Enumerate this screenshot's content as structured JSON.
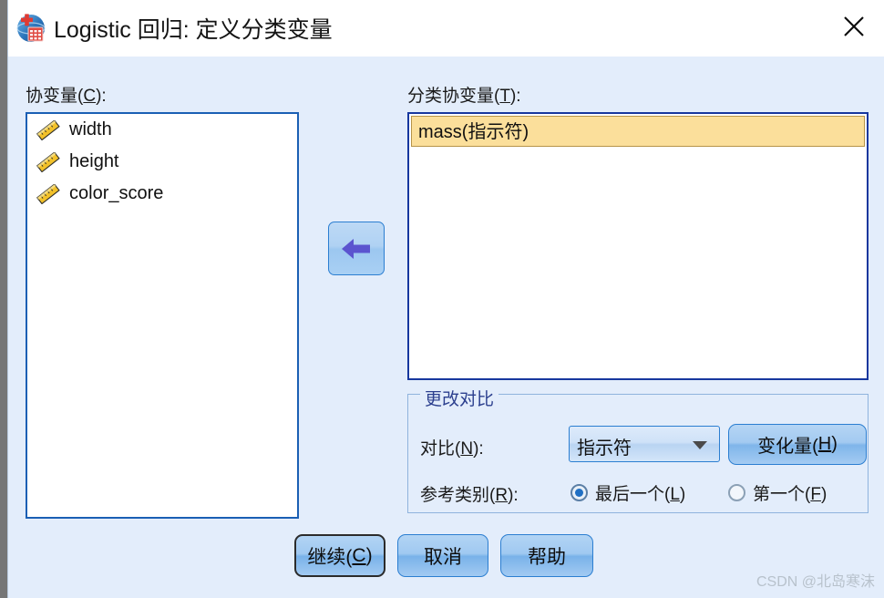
{
  "window": {
    "title": "Logistic 回归: 定义分类变量",
    "icon": "spss-logistic-icon",
    "close_label": "✕"
  },
  "left_panel": {
    "label": "协变量(C):",
    "label_text": "协变量(",
    "label_mnemonic": "C",
    "label_suffix": "):",
    "variables": [
      {
        "name": "width",
        "icon": "ruler-scale-icon"
      },
      {
        "name": "height",
        "icon": "ruler-scale-icon"
      },
      {
        "name": "color_score",
        "icon": "ruler-scale-icon"
      }
    ]
  },
  "transfer": {
    "arrow_icon": "arrow-left-icon"
  },
  "right_panel": {
    "label_text": "分类协变量(",
    "label_mnemonic": "T",
    "label_suffix": "):",
    "items": [
      {
        "name": "mass(指示符)",
        "selected": true
      }
    ]
  },
  "group": {
    "title": "更改对比",
    "contrast": {
      "label_text": "对比(",
      "label_mnemonic": "N",
      "label_suffix": "):",
      "selected": "指示符",
      "options": [
        "指示符"
      ],
      "dropdown_icon": "chevron-down-icon"
    },
    "change_button": {
      "label_text": "变化量(",
      "label_mnemonic": "H",
      "label_suffix": ")"
    },
    "reference": {
      "label_text": "参考类别(",
      "label_mnemonic": "R",
      "label_suffix": "):",
      "options": [
        {
          "label_text": "最后一个(",
          "mnemonic": "L",
          "suffix": ")",
          "checked": true
        },
        {
          "label_text": "第一个(",
          "mnemonic": "F",
          "suffix": ")",
          "checked": false
        }
      ]
    }
  },
  "footer": {
    "buttons": [
      {
        "label_text": "继续(",
        "mnemonic": "C",
        "suffix": ")",
        "default": true
      },
      {
        "label_text": "取消",
        "mnemonic": "",
        "suffix": "",
        "default": false
      },
      {
        "label_text": "帮助",
        "mnemonic": "",
        "suffix": "",
        "default": false
      }
    ]
  },
  "watermark": "CSDN @北岛寒沫",
  "colors": {
    "dialog_bg": "#e3edfb",
    "titlebar_bg": "#ffffff",
    "listbox_border": "#1a5fb4",
    "selection_bg": "#fbdf9b",
    "accent": "#2b7ed1",
    "group_title": "#2b3f8e",
    "desktop_bg": "#767676"
  }
}
